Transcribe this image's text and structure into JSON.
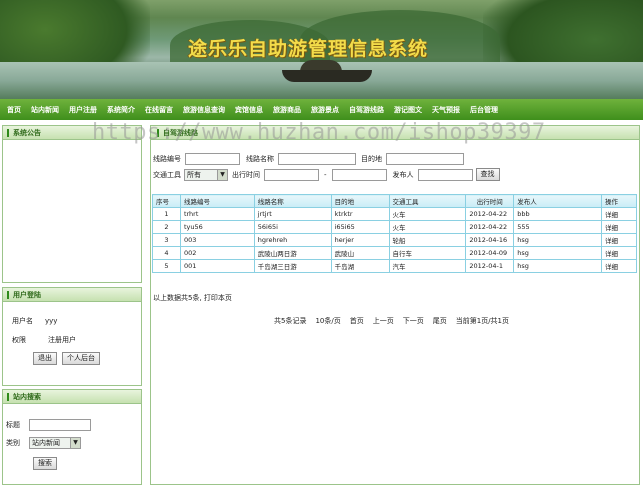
{
  "header": {
    "title": "途乐乐自助游管理信息系统"
  },
  "nav": {
    "items": [
      "首页",
      "站内新闻",
      "用户注册",
      "系统简介",
      "在线留言",
      "旅游信息查询",
      "宾馆信息",
      "旅游商品",
      "旅游景点",
      "自驾游线路",
      "游记图文",
      "天气预报",
      "后台管理"
    ]
  },
  "watermark": "https://www.huzhan.com/ishop39397",
  "notice": {
    "title": "系统公告"
  },
  "login": {
    "title": "用户登陆",
    "username_label": "用户名",
    "username_value": "yyy",
    "role_label": "权限",
    "role_value": "注册用户",
    "logout_button": "退出",
    "center_button": "个人后台"
  },
  "site_search": {
    "title": "站内搜索",
    "keyword_label": "标题",
    "keyword_value": "",
    "category_label": "类别",
    "category_value": "站内新闻",
    "submit_button": "搜索"
  },
  "main": {
    "title": "自驾游线路",
    "filters": {
      "route_no_label": "线路编号",
      "route_name_label": "线路名称",
      "destination_label": "目的地",
      "transport_label": "交通工具",
      "transport_value": "所有",
      "depart_label": "出行时间",
      "range_sep": "-",
      "publisher_label": "发布人",
      "search_button": "查找"
    },
    "table": {
      "headers": [
        "序号",
        "线路编号",
        "线路名称",
        "目的地",
        "交通工具",
        "出行时间",
        "发布人",
        "操作"
      ],
      "rows": [
        [
          "1",
          "trhrt",
          "jrtjrt",
          "ktrktr",
          "火车",
          "2012-04-22",
          "bbb",
          "详细"
        ],
        [
          "2",
          "tyu56",
          "56i65i",
          "i65i65",
          "火车",
          "2012-04-22",
          "555",
          "详细"
        ],
        [
          "3",
          "003",
          "hgrehreh",
          "herjer",
          "轮船",
          "2012-04-16",
          "hsg",
          "详细"
        ],
        [
          "4",
          "002",
          "武陵山两日游",
          "武陵山",
          "自行车",
          "2012-04-09",
          "hsg",
          "详细"
        ],
        [
          "5",
          "001",
          "千岛湖三日游",
          "千岛湖",
          "汽车",
          "2012-04-1",
          "hsg",
          "详细"
        ]
      ]
    },
    "summary": "以上数据共5条, 打印本页",
    "pagination": {
      "total": "共5条记录",
      "per_page": "10条/页",
      "first": "首页",
      "prev": "上一页",
      "next": "下一页",
      "last": "尾页",
      "current": "当前第1页/共1页"
    }
  }
}
